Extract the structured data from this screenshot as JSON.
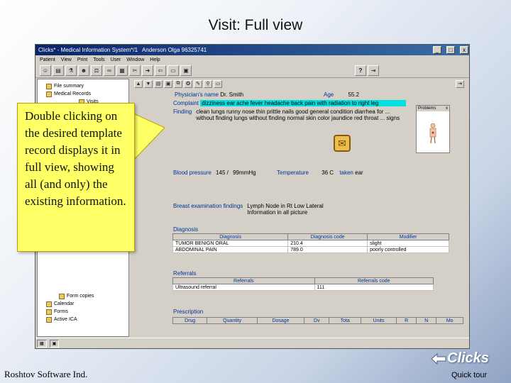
{
  "slide": {
    "title": "Visit: Full view",
    "footer_left": "Roshtov Software Ind.",
    "footer_right": "Quick tour",
    "logo_text": "Clicks"
  },
  "window": {
    "title": "Clicks* - Medical Information System*/1",
    "patient": "Anderson Olga 96325741",
    "controls": [
      "_",
      "□",
      "x"
    ]
  },
  "menu": [
    "Patient",
    "View",
    "Print",
    "Tools",
    "User",
    "Window",
    "Help"
  ],
  "tree": {
    "top_items": [
      {
        "label": "File summary"
      },
      {
        "label": "Medical Records"
      },
      {
        "label": "Visits"
      }
    ],
    "bottom_items": [
      {
        "label": "Form copies"
      },
      {
        "label": "Calendar"
      },
      {
        "label": "Forms"
      },
      {
        "label": "Active ICA"
      }
    ]
  },
  "detail": {
    "physician_label": "Physician's name",
    "physician_value": "Dr. Smith",
    "age_label": "Age",
    "age_value": "55.2",
    "complaint_label": "Complaint",
    "complaint_value": "dizziness ear ache fever headache back pain with radiation to right leg",
    "finding_label": "Finding",
    "finding_value": "clean lungs runny nose thin prittle nails good general condition diarrhea for ... without finding lungs without finding normal skin color jaundice red throat ... signs",
    "bp_label": "Blood pressure",
    "bp_sys": "145",
    "bp_sep": "/",
    "bp_dia": "99mmHg",
    "temp_label": "Temperature",
    "temp_value": "36",
    "temp_unit": "C",
    "taken_label": "taken",
    "taken_value": "ear",
    "breast_label": "Breast examination findings",
    "breast_value": "Lymph Node in Rt Low Lateral Information in all picture",
    "problems_label": "Problems",
    "problems_close": "x",
    "bell_icon": "bell-icon"
  },
  "diagnosis": {
    "title": "Diagnosis",
    "headers": [
      "Diagnosis",
      "Diagnosis code",
      "Modifier"
    ],
    "rows": [
      [
        "TUMOR BENIGN ORAL",
        "210.4",
        "slight"
      ],
      [
        "ABDOMINAL PAIN",
        "789.0",
        "poorly controlled"
      ]
    ]
  },
  "referrals": {
    "title": "Referrals",
    "headers": [
      "Referrals",
      "Referrals code"
    ],
    "rows": [
      [
        "Ultrasound referral",
        "111"
      ]
    ]
  },
  "prescription": {
    "title": "Prescription",
    "headers": [
      "Drug",
      "Quantity",
      "Dosage",
      "Dv",
      "Tota",
      "Units",
      "R",
      "N",
      "Mo"
    ]
  },
  "callout": {
    "text": "Double clicking on the desired template record displays it in full view, showing all (and only) the existing information."
  },
  "colors": {
    "callout_bg": "#ffff66",
    "complaint_highlight": "#00e0e0",
    "title_bar": "#0a246a",
    "label_blue": "#003399"
  }
}
